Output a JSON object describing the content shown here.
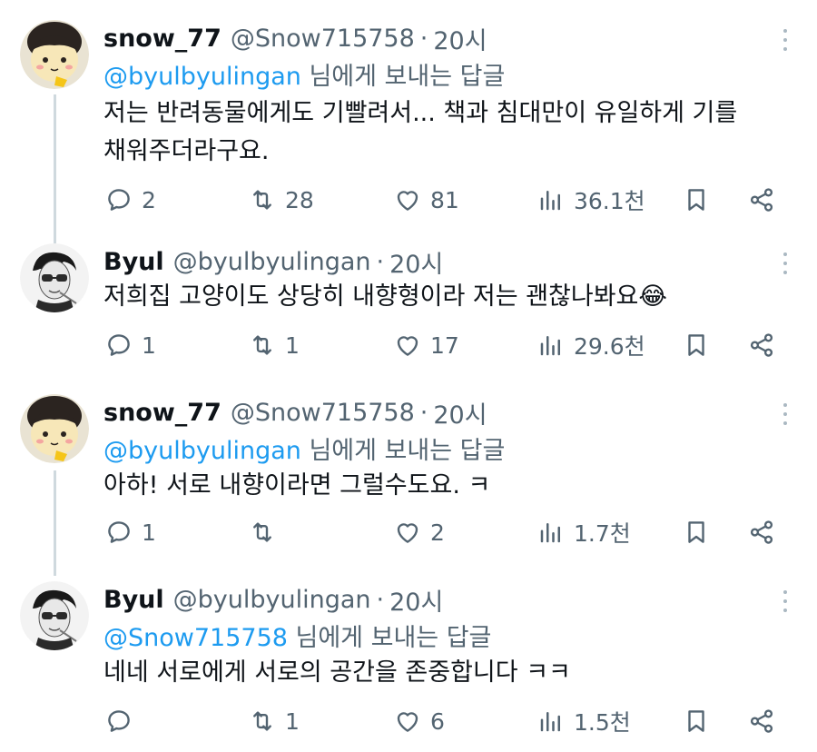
{
  "tweets": [
    {
      "name": "snow_77",
      "handle": "@Snow715758",
      "separator": "·",
      "time": "20시",
      "reply_prefix": "",
      "reply_mention": "@byulbyulingan",
      "reply_suffix": " 님에게 보내는 답글",
      "text_lines": [
        "저는 반려동물에게도 기빨려서... 책과 침대만이 유일하게 기를",
        "채워주더라구요."
      ],
      "replies": "2",
      "retweets": "28",
      "likes": "81",
      "views": "36.1천"
    },
    {
      "name": "Byul",
      "handle": "@byulbyulingan",
      "separator": "·",
      "time": "20시",
      "text_lines": [
        "저희집 고양이도 상당히 내향형이라 저는 괜찮나봐요"
      ],
      "emoji": "😂",
      "replies": "1",
      "retweets": "1",
      "likes": "17",
      "views": "29.6천"
    },
    {
      "name": "snow_77",
      "handle": "@Snow715758",
      "separator": "·",
      "time": "20시",
      "reply_mention": "@byulbyulingan",
      "reply_suffix": " 님에게 보내는 답글",
      "text_lines": [
        "아하! 서로 내향이라면 그럴수도요. ㅋ"
      ],
      "replies": "1",
      "retweets": "",
      "likes": "2",
      "views": "1.7천"
    },
    {
      "name": "Byul",
      "handle": "@byulbyulingan",
      "separator": "·",
      "time": "20시",
      "reply_mention": "@Snow715758",
      "reply_suffix": " 님에게 보내는 답글",
      "text_lines": [
        "네네 서로에게 서로의 공간을 존중합니다 ㅋㅋ"
      ],
      "replies": "",
      "retweets": "1",
      "likes": "6",
      "views": "1.5천"
    }
  ],
  "colors": {
    "text": "#0f1419",
    "secondary": "#536471",
    "mention": "#1d9bf0",
    "thread_line": "#cfd9de"
  },
  "icons": [
    "reply-icon",
    "retweet-icon",
    "like-icon",
    "views-icon",
    "bookmark-icon",
    "share-icon",
    "more-icon"
  ]
}
